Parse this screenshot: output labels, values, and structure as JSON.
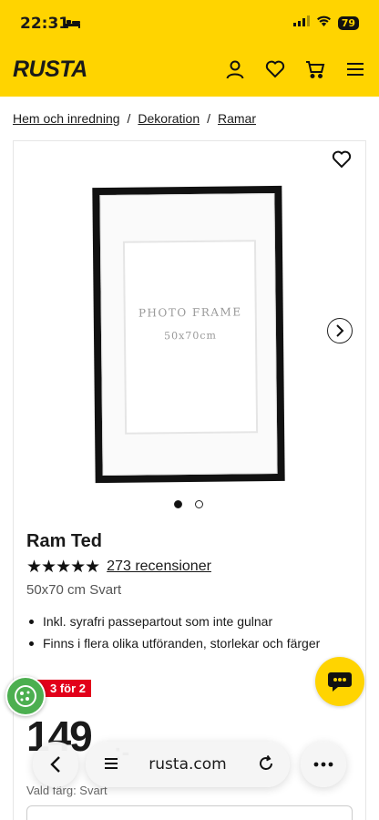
{
  "status_bar": {
    "time": "22:31",
    "battery": "79"
  },
  "header": {
    "logo": "RUSTA"
  },
  "breadcrumb": {
    "items": [
      "Hem och inredning",
      "Dekoration",
      "Ramar"
    ],
    "separator": "/"
  },
  "product": {
    "image": {
      "frame_title": "PHOTO FRAME",
      "frame_size": "50x70cm"
    },
    "carousel": {
      "current": 1,
      "total": 2
    },
    "name": "Ram Ted",
    "rating": {
      "stars": 5,
      "stars_text": "★★★★★",
      "reviews_text": "273 recensioner"
    },
    "variant": "50x70 cm Svart",
    "features": [
      "Inkl. syrafri passepartout som inte gulnar",
      "Finns i flera olika utföranden, storlekar och färger"
    ],
    "promo_badge": "3 för 2",
    "price": "149",
    "price_suffix": ":-",
    "chosen_color_label": "Vald färg: Svart"
  },
  "browser": {
    "url": "rusta.com"
  },
  "colors": {
    "brand_yellow": "#ffd400",
    "promo_red": "#e2001a",
    "cookie_green": "#4caf50"
  }
}
